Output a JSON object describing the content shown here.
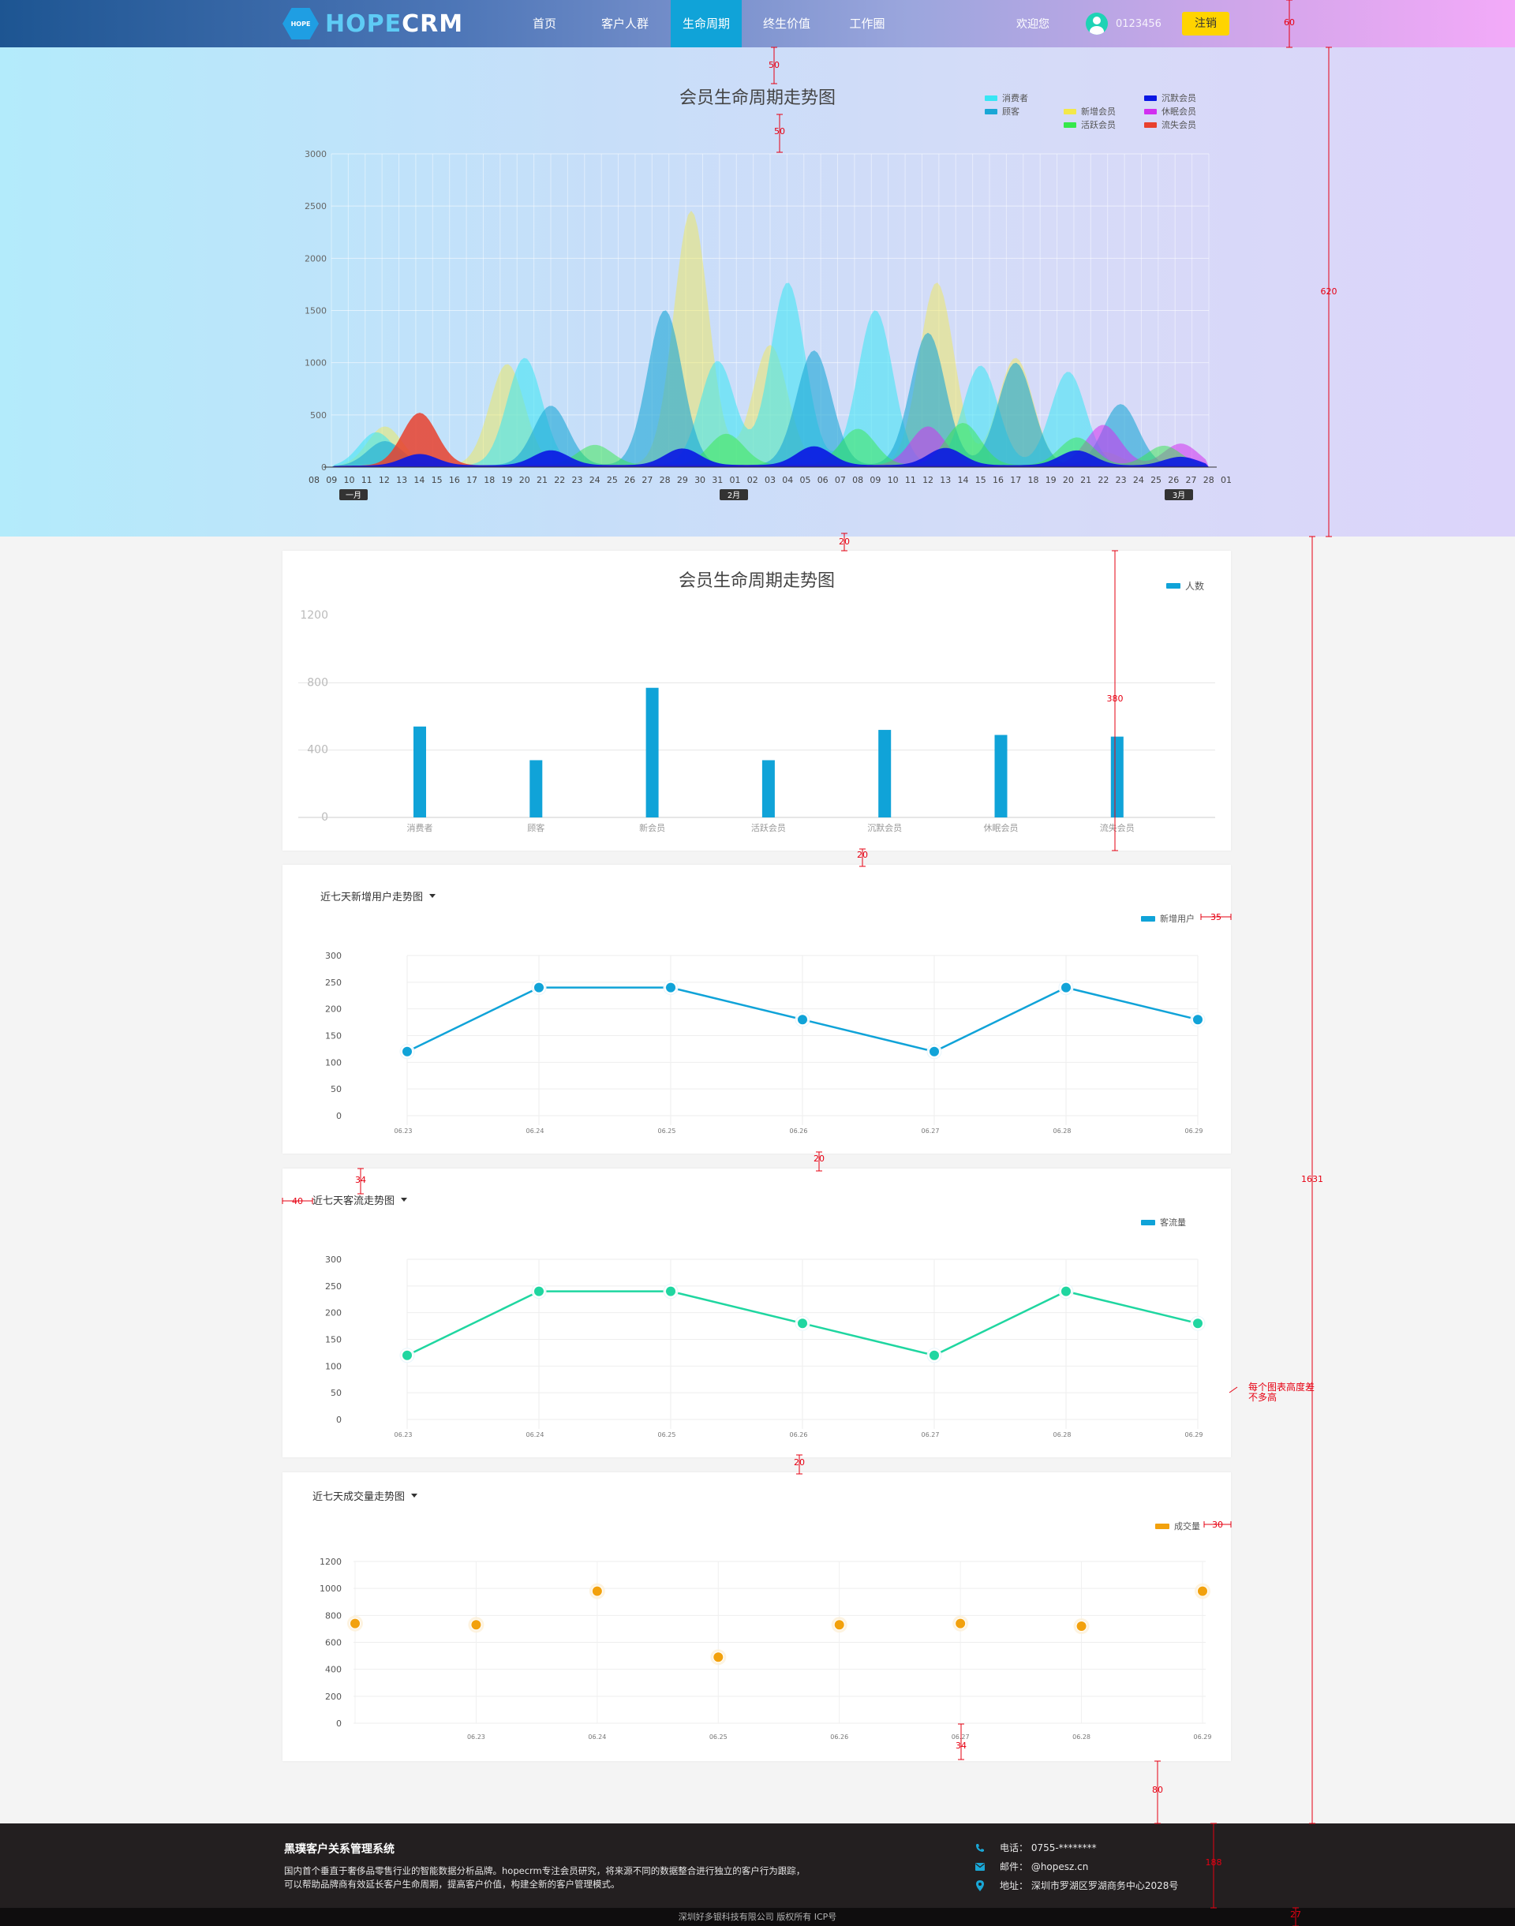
{
  "header": {
    "logo_badge": "HOPE",
    "logo_text_a": "HOPE",
    "logo_text_b": "CRM",
    "nav": [
      {
        "label": "首页",
        "active": false
      },
      {
        "label": "客户人群",
        "active": false
      },
      {
        "label": "生命周期",
        "active": true
      },
      {
        "label": "终生价值",
        "active": false
      },
      {
        "label": "工作圈",
        "active": false
      }
    ],
    "welcome": "欢迎您",
    "user_id": "0123456",
    "logout": "注销"
  },
  "colors": {
    "accent": "#10a3d8",
    "logout": "#ffd400",
    "line_new_users": "#10a3d8",
    "line_traffic": "#1fd6a0",
    "scatter_deals": "#f2a10d",
    "annotation": "#e60012"
  },
  "hero": {
    "title": "会员生命周期走势图",
    "legend": [
      {
        "label": "消费者",
        "color": "#38e6f4"
      },
      {
        "label": "顾客",
        "color": "#1aa7d6"
      },
      {
        "label": "新增会员",
        "color": "#f3e84a"
      },
      {
        "label": "活跃会员",
        "color": "#35e84b"
      },
      {
        "label": "沉默会员",
        "color": "#0a17e3"
      },
      {
        "label": "休眠会员",
        "color": "#d12ff0"
      },
      {
        "label": "流失会员",
        "color": "#e8412e"
      }
    ],
    "y_ticks": [
      "3000",
      "2500",
      "2000",
      "1500",
      "1000",
      "500",
      "0"
    ],
    "x_ticks": [
      "08",
      "09",
      "10",
      "11",
      "12",
      "13",
      "14",
      "15",
      "16",
      "17",
      "18",
      "19",
      "20",
      "21",
      "22",
      "23",
      "24",
      "25",
      "26",
      "27",
      "28",
      "29",
      "30",
      "31",
      "01",
      "02",
      "03",
      "04",
      "05",
      "06",
      "07",
      "08",
      "09",
      "10",
      "11",
      "12",
      "13",
      "14",
      "15",
      "16",
      "17",
      "18",
      "19",
      "20",
      "21",
      "22",
      "23",
      "24",
      "25",
      "26",
      "27",
      "28",
      "01"
    ],
    "month_badges": [
      "一月",
      "2月",
      "3月"
    ]
  },
  "bar_card": {
    "title": "会员生命周期走势图",
    "legend": "人数"
  },
  "line_card_1": {
    "title": "近七天新增用户走势图",
    "legend": "新增用户"
  },
  "line_card_2": {
    "title": "近七天客流走势图",
    "legend": "客流量"
  },
  "scatter_card": {
    "title": "近七天成交量走势图",
    "legend": "成交量"
  },
  "chart_data": [
    {
      "type": "area",
      "title": "会员生命周期走势图",
      "ylim": [
        0,
        3000
      ],
      "series_peaks": [
        {
          "name": "消费者",
          "values": [
            420,
            1100,
            1000,
            1750,
            1500,
            1000,
            1000
          ]
        },
        {
          "name": "顾客",
          "values": [
            300,
            600,
            1500,
            1100,
            1300,
            1050,
            700
          ]
        },
        {
          "name": "新增会员",
          "values": [
            480,
            1050,
            2450,
            1150,
            1800,
            1100,
            150
          ]
        },
        {
          "name": "活跃会员",
          "values": [
            120,
            200,
            300,
            350,
            420,
            300,
            250
          ]
        },
        {
          "name": "沉默会员",
          "values": [
            130,
            150,
            160,
            180,
            170,
            160,
            120
          ]
        },
        {
          "name": "休眠会员",
          "values": [
            0,
            0,
            0,
            0,
            380,
            450,
            300
          ]
        },
        {
          "name": "流失会员",
          "values": [
            600,
            0,
            0,
            0,
            0,
            0,
            0
          ]
        }
      ]
    },
    {
      "type": "bar",
      "title": "会员生命周期走势图",
      "categories": [
        "消费者",
        "顾客",
        "新会员",
        "活跃会员",
        "沉默会员",
        "休眠会员",
        "流失会员"
      ],
      "series": [
        {
          "name": "人数",
          "values": [
            540,
            340,
            770,
            340,
            520,
            490,
            480
          ]
        }
      ],
      "y_ticks": [
        "1200",
        "800",
        "400",
        "0"
      ],
      "ylim": [
        0,
        1200
      ]
    },
    {
      "type": "line",
      "title": "近七天新增用户走势图",
      "categories": [
        "06.23",
        "06.24",
        "06.25",
        "06.26",
        "06.27",
        "06.28",
        "06.29"
      ],
      "series": [
        {
          "name": "新增用户",
          "values": [
            120,
            240,
            240,
            180,
            120,
            240,
            180
          ]
        }
      ],
      "y_ticks": [
        "300",
        "250",
        "200",
        "150",
        "100",
        "50",
        "0"
      ],
      "ylim": [
        0,
        300
      ]
    },
    {
      "type": "line",
      "title": "近七天客流走势图",
      "categories": [
        "06.23",
        "06.24",
        "06.25",
        "06.26",
        "06.27",
        "06.28",
        "06.29"
      ],
      "series": [
        {
          "name": "客流量",
          "values": [
            120,
            240,
            240,
            180,
            120,
            240,
            180
          ]
        }
      ],
      "y_ticks": [
        "300",
        "250",
        "200",
        "150",
        "100",
        "50",
        "0"
      ],
      "ylim": [
        0,
        300
      ]
    },
    {
      "type": "scatter",
      "title": "近七天成交量走势图",
      "categories": [
        "",
        "06.23",
        "06.24",
        "06.25",
        "06.26",
        "06.27",
        "06.28",
        "06.29"
      ],
      "series": [
        {
          "name": "成交量",
          "values": [
            740,
            730,
            980,
            490,
            730,
            740,
            720,
            980
          ]
        }
      ],
      "y_ticks": [
        "1200",
        "1000",
        "800",
        "600",
        "400",
        "200",
        "0"
      ],
      "ylim": [
        0,
        1200
      ]
    }
  ],
  "annotations": {
    "labels": [
      "60",
      "50",
      "50",
      "620",
      "20",
      "380",
      "20",
      "35",
      "20",
      "34",
      "40",
      "1631",
      "20",
      "30",
      "34",
      "80",
      "188",
      "27"
    ],
    "note_line1": "每个图表高度差",
    "note_line2": "不多高"
  },
  "footer": {
    "title": "黑璞客户关系管理系统",
    "desc_line1": "国内首个垂直于奢侈品零售行业的智能数据分析品牌。hopecrm专注会员研究，将来源不同的数据整合进行独立的客户行为跟踪，",
    "desc_line2": "可以帮助品牌商有效延长客户生命周期，提高客户价值，构建全新的客户管理模式。",
    "phone": "电话：  0755-********",
    "email": "邮件：  @hopesz.cn",
    "address": "地址：  深圳市罗湖区罗湖商务中心2028号",
    "copyright": "深圳好多银科技有限公司 版权所有 ICP号"
  }
}
